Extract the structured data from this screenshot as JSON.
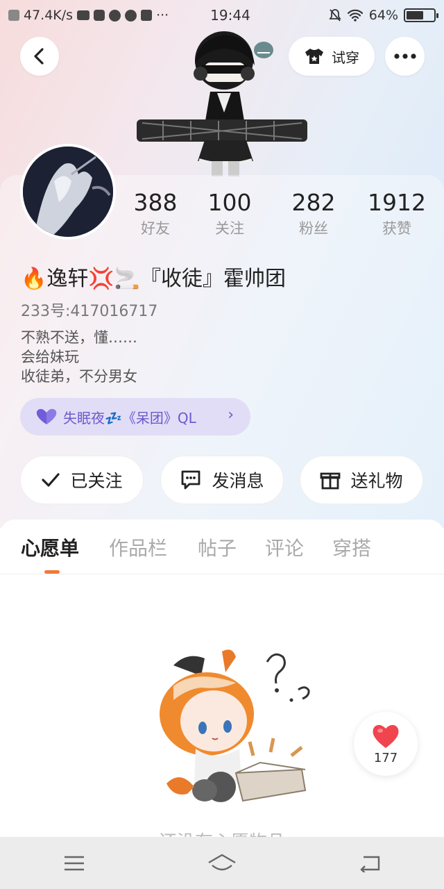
{
  "status_bar": {
    "net_speed": "47.4K/s",
    "time": "19:44",
    "battery": "64%",
    "battery_level": 0.64
  },
  "header": {
    "try_on_label": "试穿"
  },
  "stats": [
    {
      "value": "388",
      "label": "好友"
    },
    {
      "value": "100",
      "label": "关注"
    },
    {
      "value": "282",
      "label": "粉丝"
    },
    {
      "value": "1912",
      "label": "获赞"
    }
  ],
  "profile": {
    "username": "🔥逸轩💢🚬『收徒』霍帅团",
    "uid": "233号:417016717",
    "bio": [
      "不熟不送，懂……",
      "会给妹玩",
      "收徒弟，不分男女"
    ],
    "club": "失眠夜💤《呆团》QL"
  },
  "actions": {
    "follow": "已关注",
    "message": "发消息",
    "gift": "送礼物"
  },
  "tabs": [
    "心愿单",
    "作品栏",
    "帖子",
    "评论",
    "穿搭"
  ],
  "empty_text": "还没有心愿物品",
  "like": {
    "count": "177"
  },
  "colors": {
    "accent": "#f07a3a",
    "club": "#6a5acd",
    "heart": "#f0444f"
  }
}
